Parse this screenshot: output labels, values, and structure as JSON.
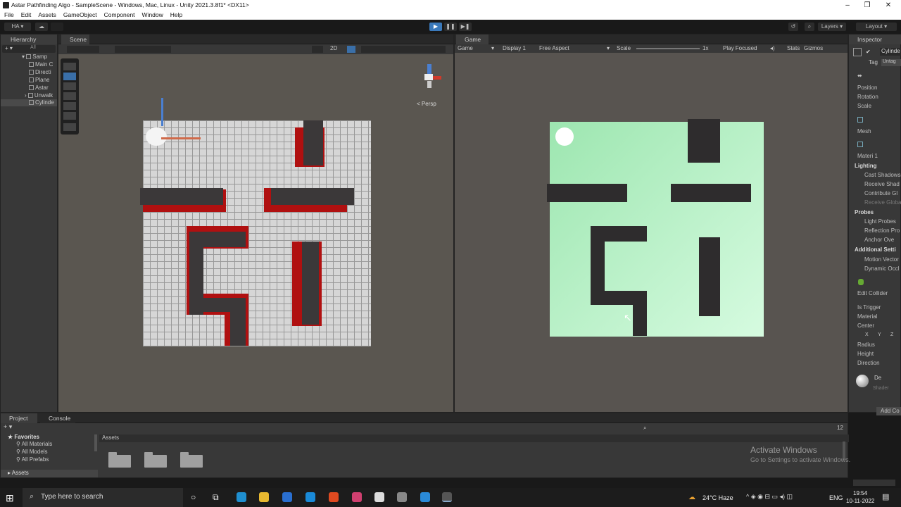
{
  "window": {
    "title": "Astar Pathfinding Algo - SampleScene - Windows, Mac, Linux - Unity 2021.3.8f1* <DX11>",
    "controls": [
      "–",
      "❐",
      "✕"
    ]
  },
  "menu": [
    "File",
    "Edit",
    "Assets",
    "GameObject",
    "Component",
    "Window",
    "Help"
  ],
  "toolbar": {
    "account": "HA",
    "play": "▶",
    "pause": "❚❚",
    "step": "▶❚",
    "layers": "Layers",
    "layout": "Layout"
  },
  "hierarchy": {
    "tab": "Hierarchy",
    "search": "All",
    "items": [
      "Samp",
      "Main C",
      "Directi",
      "Plane",
      "Astar",
      "Unwalk",
      "Cylinde"
    ]
  },
  "scene": {
    "tab": "Scene",
    "mode2d": "2D",
    "persp": "< Persp"
  },
  "game": {
    "tab": "Game",
    "mode": "Game",
    "display": "Display 1",
    "aspect": "Free Aspect",
    "scale_label": "Scale",
    "scale_value": "1x",
    "play_focus": "Play Focused",
    "stats": "Stats",
    "gizmos": "Gizmos"
  },
  "inspector": {
    "tab": "Inspector",
    "object_name": "Cylinde",
    "tag_label": "Tag",
    "tag_value": "Untag",
    "transform": [
      "Position",
      "Rotation",
      "Scale"
    ],
    "mesh_label": "Mesh",
    "materials": "Materi 1",
    "lighting": "Lighting",
    "lighting_items": [
      "Cast Shadows",
      "Receive Shad",
      "Contribute Gl",
      "Receive Globa"
    ],
    "probes": "Probes",
    "probe_items": [
      "Light Probes",
      "Reflection Pro",
      "Anchor Ove"
    ],
    "additional": "Additional Setti",
    "additional_items": [
      "Motion Vector",
      "Dynamic Occl"
    ],
    "collider": [
      "Edit Collider",
      "Is Trigger",
      "Material",
      "Center",
      "Radius",
      "Height",
      "Direction"
    ],
    "xyz": [
      "X",
      "Y",
      "Z"
    ],
    "material_name": "De",
    "shader": "Shader",
    "add_component": "Add Co"
  },
  "project": {
    "tabs": [
      "Project",
      "Console"
    ],
    "favorites": "Favorites",
    "fav_items": [
      "All Materials",
      "All Models",
      "All Prefabs"
    ],
    "assets_root": "Assets",
    "breadcrumb": "Assets",
    "count": "12"
  },
  "watermark": {
    "line1": "Activate Windows",
    "line2": "Go to Settings to activate Windows."
  },
  "taskbar": {
    "search_placeholder": "Type here to search",
    "weather": "24°C  Haze",
    "lang": "ENG",
    "time": "19:54",
    "date": "10-11-2022"
  }
}
